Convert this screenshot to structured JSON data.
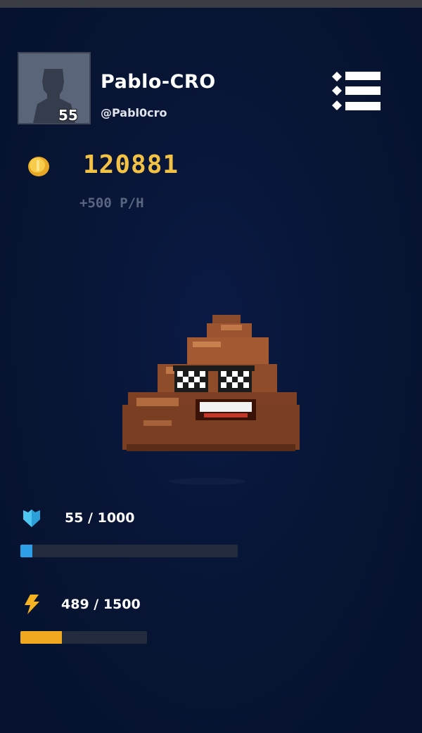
{
  "profile": {
    "username": "Pablo-CRO",
    "handle": "@Pabl0cro",
    "level": "55"
  },
  "wallet": {
    "balance": "120881",
    "rate": "+500 P/H",
    "coin_color": "#f3c244"
  },
  "mascot": {
    "icon": "poop-sunglasses-icon"
  },
  "stats": {
    "shield": {
      "label": "55 / 1000",
      "current": 55,
      "max": 1000,
      "color": "#2e9ee6"
    },
    "energy": {
      "label": "489 / 1500",
      "current": 489,
      "max": 1500,
      "color": "#f0a820"
    }
  },
  "icons": [
    "avatar-silhouette-icon",
    "menu-list-icon",
    "coin-icon",
    "poop-sunglasses-icon",
    "shield-icon",
    "lightning-icon"
  ]
}
